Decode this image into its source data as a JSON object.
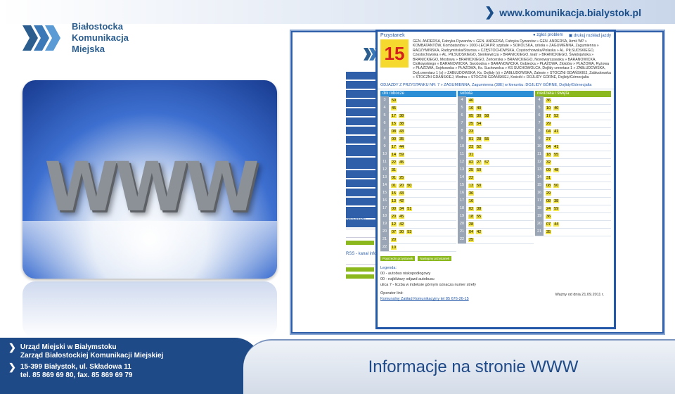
{
  "header": {
    "url": "www.komunikacja.bialystok.pl"
  },
  "logo": {
    "line1": "Białostocka",
    "line2": "Komunikacja",
    "line3": "Miejska"
  },
  "illustration": {
    "text": "WWW"
  },
  "panel": {
    "title": "Przystanek",
    "link_report": "zgłoś problem",
    "link_print": "drukuj rozkład jazdy",
    "route_number": "15",
    "route_description": "GEN. ANDERSA, Fabryka Dywanów » GEN. ANDERSA, Fabryka Dywanów » GEN. ANDERSA, Armii WP » KOMBATANTÓW, Kombatantów » 1000-LECIA PP, szpitale » SOKÓLSKA, szkoła » ZAGUMIENNA, Zagumienna » RADZYMIŃSKA, Radzymińska/Starosa » CZĘSTOCHOWSKA, Częstochowska/Polaska » AL. PIŁSUDSKIEGO, Częstochowska » AL. PIŁSUDSKIEGO, Sienkiewicza » BRANICKIEGO, teatr » BRANICKIEGO, Świętojańska » BRANICKIEGO, Mostowa » BRANICKIEGO, Żeńcerska » BRANICKIEGO, Nowowarszawska » BARANOWICKA, Ciołkowskiego » BARANOWICKA, Swobodna » BARANOWICKA, Gobiecka » PŁAŻOWA, Złotdów » PŁAŻOWA, Ryżowa » PŁAŻOWA, Sojrkowska » PŁAŻOWA, Ks. Suchowolca » KS SUCHOWOLCA, Dojlidy cmentarz 1 » ZABŁUDOWSKA, Dojl.cmentarz 1 (s) » ZABŁUDOWSKA, Ks. Dojlidy (s) » ZABŁUDOWSKA, Zalesie » STOCZNI GDAŃSKIEJ, Zabłudowska » STOCZNI GDAŃSKIEJ, Wodna » STOCZNI GDAŃSKIEJ, Kościół » DOJLIDY GÓRNE, Dojlidy/Górnecjalta",
    "direction": "ODJAZDY Z PRZYSTANKU NR: 7 » ZAGUMIENNA, Zagumienna (38E) w kierunku: DOJLIDY GÓRNE, Dojlidy/Górnecjalta",
    "columns": [
      {
        "name": "dni robocze",
        "rows": [
          {
            "h": "3",
            "m": [
              "59"
            ]
          },
          {
            "h": "4",
            "m": [
              "45"
            ]
          },
          {
            "h": "5",
            "m": [
              "17",
              "38"
            ]
          },
          {
            "h": "6",
            "m": [
              "15",
              "38"
            ]
          },
          {
            "h": "7",
            "m": [
              "08",
              "43"
            ]
          },
          {
            "h": "8",
            "m": [
              "00",
              "35"
            ]
          },
          {
            "h": "9",
            "m": [
              "17",
              "44"
            ]
          },
          {
            "h": "10",
            "m": [
              "14",
              "59"
            ]
          },
          {
            "h": "11",
            "m": [
              "22",
              "45"
            ]
          },
          {
            "h": "12",
            "m": [
              "31"
            ]
          },
          {
            "h": "13",
            "m": [
              "01",
              "25"
            ]
          },
          {
            "h": "14",
            "m": [
              "01",
              "20",
              "50"
            ]
          },
          {
            "h": "15",
            "m": [
              "15",
              "43"
            ]
          },
          {
            "h": "16",
            "m": [
              "13",
              "42"
            ]
          },
          {
            "h": "17",
            "m": [
              "00",
              "34",
              "51"
            ]
          },
          {
            "h": "18",
            "m": [
              "20",
              "45"
            ]
          },
          {
            "h": "19",
            "m": [
              "12",
              "42"
            ]
          },
          {
            "h": "20",
            "m": [
              "07",
              "30",
              "53"
            ]
          },
          {
            "h": "21",
            "m": [
              "20"
            ]
          },
          {
            "h": "22",
            "m": [
              "10"
            ]
          }
        ]
      },
      {
        "name": "sobota",
        "rows": [
          {
            "h": "4",
            "m": [
              "46"
            ]
          },
          {
            "h": "5",
            "m": [
              "16",
              "40"
            ]
          },
          {
            "h": "6",
            "m": [
              "05",
              "30",
              "58"
            ]
          },
          {
            "h": "7",
            "m": [
              "25",
              "54"
            ]
          },
          {
            "h": "8",
            "m": [
              "23"
            ]
          },
          {
            "h": "9",
            "m": [
              "01",
              "28",
              "55"
            ]
          },
          {
            "h": "10",
            "m": [
              "23",
              "52"
            ]
          },
          {
            "h": "11",
            "m": [
              "31"
            ]
          },
          {
            "h": "12",
            "m": [
              "02",
              "27",
              "57"
            ]
          },
          {
            "h": "13",
            "m": [
              "25",
              "50"
            ]
          },
          {
            "h": "14",
            "m": [
              "22"
            ]
          },
          {
            "h": "15",
            "m": [
              "13",
              "50"
            ]
          },
          {
            "h": "16",
            "m": [
              "36"
            ]
          },
          {
            "h": "17",
            "m": [
              "16"
            ]
          },
          {
            "h": "18",
            "m": [
              "02",
              "38"
            ]
          },
          {
            "h": "19",
            "m": [
              "18",
              "55"
            ]
          },
          {
            "h": "20",
            "m": [
              "28"
            ]
          },
          {
            "h": "21",
            "m": [
              "04",
              "42"
            ]
          },
          {
            "h": "22",
            "m": [
              "25"
            ]
          }
        ]
      },
      {
        "name": "niedziela i święta",
        "rows": [
          {
            "h": "4",
            "m": [
              "36"
            ]
          },
          {
            "h": "5",
            "m": [
              "10",
              "40"
            ]
          },
          {
            "h": "6",
            "m": [
              "17",
              "52"
            ]
          },
          {
            "h": "7",
            "m": [
              "29"
            ]
          },
          {
            "h": "8",
            "m": [
              "04",
              "41"
            ]
          },
          {
            "h": "9",
            "m": [
              "27"
            ]
          },
          {
            "h": "10",
            "m": [
              "04",
              "41"
            ]
          },
          {
            "h": "11",
            "m": [
              "18",
              "55"
            ]
          },
          {
            "h": "12",
            "m": [
              "32"
            ]
          },
          {
            "h": "13",
            "m": [
              "09",
              "48"
            ]
          },
          {
            "h": "14",
            "m": [
              "31"
            ]
          },
          {
            "h": "15",
            "m": [
              "08",
              "50"
            ]
          },
          {
            "h": "16",
            "m": [
              "29"
            ]
          },
          {
            "h": "17",
            "m": [
              "08",
              "38"
            ]
          },
          {
            "h": "18",
            "m": [
              "24",
              "59"
            ]
          },
          {
            "h": "19",
            "m": [
              "36"
            ]
          },
          {
            "h": "20",
            "m": [
              "07",
              "44"
            ]
          },
          {
            "h": "21",
            "m": [
              "35"
            ]
          }
        ]
      }
    ],
    "button_previous": "Poprzedni przystanek",
    "button_next": "Następny przystanek",
    "legend_title": "Legenda:",
    "legend_1": "00 - autobus niskopodłogowy",
    "legend_2": "00 - najbliższy odjazd autobusu",
    "legend_3": "ulica 7 - liczba w indeksie górnym oznacza numer strefy",
    "valid_from": "Ważny od dnia 21.09.2011 r.",
    "operator_label": "Operator linii:",
    "operator_link": "Komunalny Zakład Komunikacyjny tel 85 676-26-15"
  },
  "background_site": {
    "newsletter": "Newsletter",
    "rss": "RSS - kanał info"
  },
  "footer": {
    "line1": "Urząd Miejski w Białymstoku",
    "line2": "Zarząd Białostockiej Komunikacji Miejskiej",
    "line3": "15-399 Białystok, ul. Składowa 11",
    "line4": "tel. 85 869 69 80, fax. 85 869 69 79"
  },
  "slide_title": "Informacje na stronie WWW",
  "colors": {
    "brand_blue": "#1f4a88",
    "accent_yellow": "#f5d92e",
    "accent_green": "#8bb81c",
    "accent_red": "#d41f1f"
  }
}
